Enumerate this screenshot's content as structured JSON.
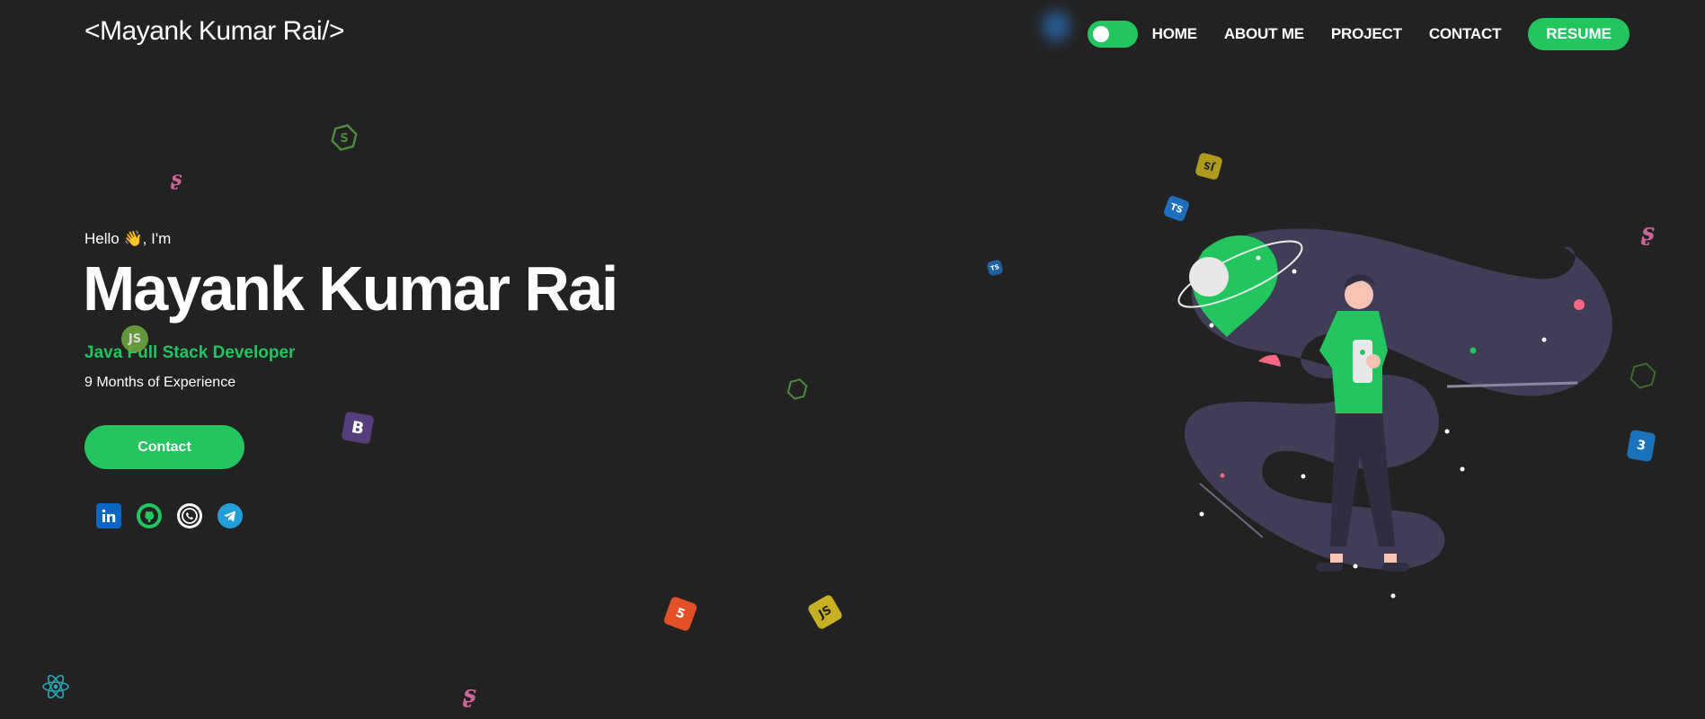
{
  "header": {
    "logo": "<Mayank Kumar Rai/>",
    "nav_items": [
      "HOME",
      "ABOUT ME",
      "PROJECT",
      "CONTACT"
    ],
    "resume_label": "RESUME",
    "theme_toggle": "on"
  },
  "hero": {
    "greeting_prefix": "Hello",
    "greeting_suffix": ", I'm",
    "name": "Mayank Kumar Rai",
    "role": "Java Full Stack Developer",
    "experience": "9 Months of Experience",
    "contact_label": "Contact"
  },
  "socials": [
    "linkedin-icon",
    "github-icon",
    "whatsapp-icon",
    "telegram-icon"
  ],
  "colors": {
    "background": "#222222",
    "accent": "#22c55e",
    "text": "#ffffff"
  }
}
